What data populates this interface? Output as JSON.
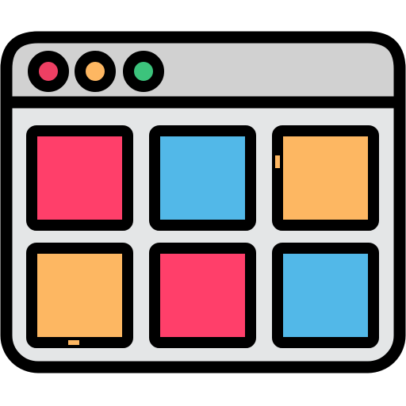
{
  "icon": {
    "name": "browser-window-grid-icon",
    "window_dots": [
      {
        "name": "close-dot",
        "color": "#ee3f63"
      },
      {
        "name": "minimize-dot",
        "color": "#fdb762"
      },
      {
        "name": "maximize-dot",
        "color": "#3cc37c"
      }
    ],
    "tiles": [
      {
        "name": "tile-red",
        "color": "#ff3f6a"
      },
      {
        "name": "tile-blue",
        "color": "#52b8e8"
      },
      {
        "name": "tile-orange",
        "color": "#fdb762"
      },
      {
        "name": "tile-orange",
        "color": "#fdb762"
      },
      {
        "name": "tile-red",
        "color": "#ff3f6a"
      },
      {
        "name": "tile-blue",
        "color": "#52b8e8"
      }
    ],
    "colors": {
      "outline": "#000000",
      "title_bar": "#d1d1d1",
      "window_body": "#e4e6e7"
    }
  }
}
